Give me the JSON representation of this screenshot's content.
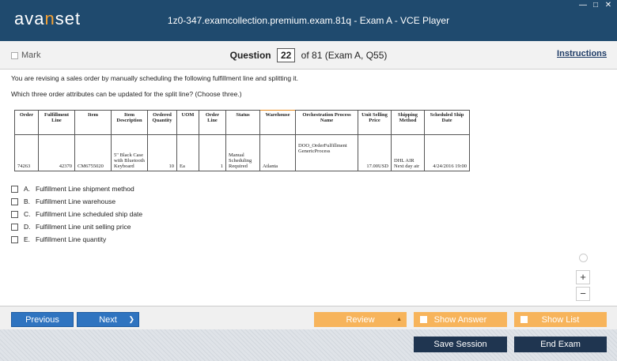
{
  "window": {
    "logo_pre": "ava",
    "logo_accent": "n",
    "logo_post": "set",
    "title": "1z0-347.examcollection.premium.exam.81q - Exam A - VCE Player",
    "controls": [
      "—",
      "□",
      "✕"
    ]
  },
  "question_bar": {
    "mark_label": "Mark",
    "question_label": "Question",
    "question_number": "22",
    "of_text": "of 81 (Exam A, Q55)",
    "instructions_label": "Instructions"
  },
  "question": {
    "line1": "You are revising a sales order by manually scheduling the following fulfillment line and splitting it.",
    "line2": "Which three order attributes can be updated for the split line? (Choose three.)"
  },
  "exhibit": {
    "headers": [
      "Order",
      "Fulfillment Line",
      "Item",
      "Item Description",
      "Ordered Quantity",
      "UOM",
      "Order Line",
      "Status",
      "Warehouse",
      "Orchestration Process Name",
      "Unit Selling Price",
      "Shipping Method",
      "Scheduled Ship Date"
    ],
    "row": [
      "74263",
      "42370",
      "CM6755020",
      "5\" Black Case with Bluetooth Keyboard",
      "10",
      "Ea",
      "1",
      "Manual Scheduling Required",
      "Atlanta",
      "DOO_OrderFulfillment GenericProcess",
      "17.00USD",
      "DHL AIR Next day air",
      "4/24/2016 19:00"
    ]
  },
  "options": [
    {
      "letter": "A.",
      "text": "Fulfillment Line shipment method"
    },
    {
      "letter": "B.",
      "text": "Fulfillment Line warehouse"
    },
    {
      "letter": "C.",
      "text": "Fulfillment Line scheduled ship date"
    },
    {
      "letter": "D.",
      "text": "Fulfillment Line unit selling price"
    },
    {
      "letter": "E.",
      "text": "Fulfillment Line quantity"
    }
  ],
  "zoom": {
    "plus": "+",
    "minus": "−"
  },
  "nav": {
    "previous": "Previous",
    "next": "Next",
    "next_arrow": "❯",
    "review": "Review",
    "review_arrow": "▲",
    "show_answer": "Show Answer",
    "show_list": "Show List",
    "save_session": "Save Session",
    "end_exam": "End Exam"
  },
  "colors": {
    "titlebar": "#1f4a6e",
    "accent": "#f7a234",
    "primary_button": "#2f74c0",
    "secondary_button": "#f7b45b",
    "dark_button": "#1f3550"
  }
}
